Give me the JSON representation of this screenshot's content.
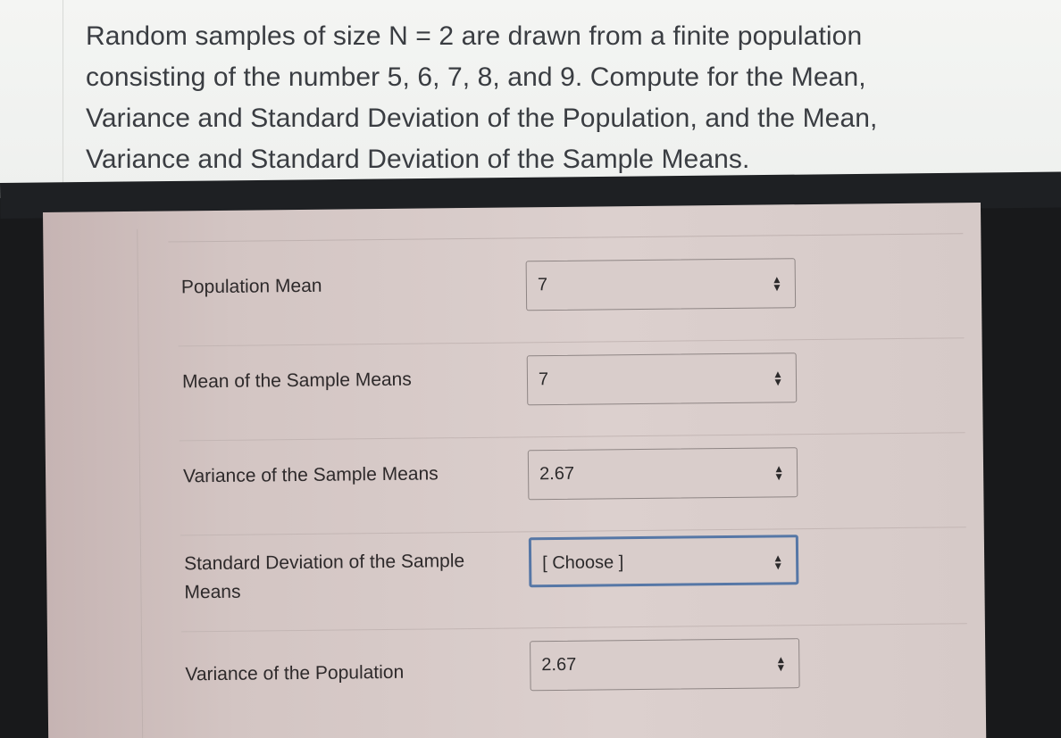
{
  "question": {
    "lines": [
      "Random samples of size N = 2 are drawn from a finite population",
      "consisting of the number 5, 6, 7, 8, and 9. Compute for the Mean,",
      "Variance and Standard Deviation of the Population, and the Mean,",
      "Variance and Standard Deviation of the Sample Means."
    ]
  },
  "answers": [
    {
      "label": "Population Mean",
      "value": "7"
    },
    {
      "label": "Mean of the Sample Means",
      "value": "7"
    },
    {
      "label": "Variance of the Sample Means",
      "value": "2.67"
    },
    {
      "label": "Standard Deviation of the Sample Means",
      "value": "[ Choose ]"
    },
    {
      "label": "Variance of the Population",
      "value": "2.67"
    }
  ],
  "icons": {
    "dropdown": "chevron-up-down-icon"
  },
  "colors": {
    "focus_border": "#5677a6",
    "card_background": "#d6cac8",
    "question_background": "#f4f5f3"
  }
}
